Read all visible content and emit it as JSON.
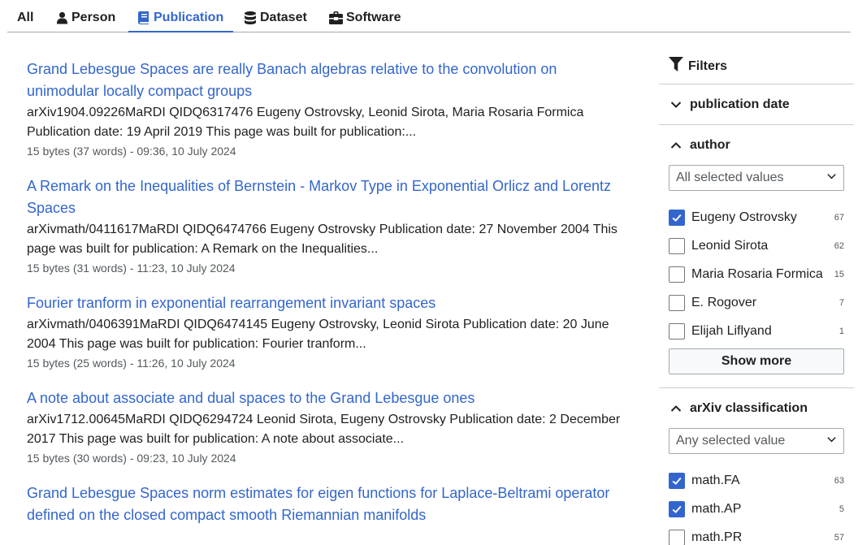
{
  "tabs": [
    {
      "label": "All",
      "icon": "none"
    },
    {
      "label": "Person",
      "icon": "person-icon"
    },
    {
      "label": "Publication",
      "icon": "book-icon"
    },
    {
      "label": "Dataset",
      "icon": "database-icon"
    },
    {
      "label": "Software",
      "icon": "toolbox-icon"
    }
  ],
  "active_tab": "Publication",
  "accent_color": "#3366cc",
  "results": [
    {
      "title_l1": "Grand Lebesgue Spaces are really Banach algebras relative to the convolution on",
      "title_l2": "unimodular locally compact groups",
      "snippet_l1": "arXiv1904.09226MaRDI QIDQ6317476 Eugeny Ostrovsky, Leonid Sirota, Maria Rosaria Formica",
      "snippet_l2": "Publication date: 19 April 2019 This page was built for publication:...",
      "meta": "15 bytes (37 words) - 09:36, 10 July 2024"
    },
    {
      "title_l1": "A Remark on the Inequalities of Bernstein - Markov Type in Exponential Orlicz and Lorentz",
      "title_l2": "Spaces",
      "snippet_l1": "arXivmath/0411617MaRDI QIDQ6474766 Eugeny Ostrovsky Publication date: 27 November 2004 This",
      "snippet_l2": "page was built for publication: A Remark on the Inequalities...",
      "meta": "15 bytes (31 words) - 11:23, 10 July 2024"
    },
    {
      "title_l1": "Fourier tranform in exponential rearrangement invariant spaces",
      "title_l2": "",
      "snippet_l1": "arXivmath/0406391MaRDI QIDQ6474145 Eugeny Ostrovsky, Leonid Sirota Publication date: 20 June",
      "snippet_l2": "2004 This page was built for publication: Fourier tranform...",
      "meta": "15 bytes (25 words) - 11:26, 10 July 2024"
    },
    {
      "title_l1": "A note about associate and dual spaces to the Grand Lebesgue ones",
      "title_l2": "",
      "snippet_l1": "arXiv1712.00645MaRDI QIDQ6294724 Leonid Sirota, Eugeny Ostrovsky Publication date: 2 December",
      "snippet_l2": "2017 This page was built for publication: A note about associate...",
      "meta": "15 bytes (30 words) - 09:23, 10 July 2024"
    },
    {
      "title_l1": "Grand Lebesgue Spaces norm estimates for eigen functions for Laplace-Beltrami operator",
      "title_l2": "defined on the closed compact smooth Riemannian manifolds",
      "snippet_l1": "",
      "snippet_l2": "",
      "meta": ""
    }
  ],
  "sidebar": {
    "filters_label": "Filters",
    "publication_date": {
      "label": "publication date",
      "expanded": false
    },
    "author": {
      "label": "author",
      "expanded": true,
      "select_value": "All selected values",
      "options": [
        {
          "label": "Eugeny Ostrovsky",
          "count": "67",
          "checked": true
        },
        {
          "label": "Leonid Sirota",
          "count": "62",
          "checked": false
        },
        {
          "label": "Maria Rosaria Formica",
          "count": "15",
          "checked": false
        },
        {
          "label": "E. Rogover",
          "count": "7",
          "checked": false
        },
        {
          "label": "Elijah Liflyand",
          "count": "1",
          "checked": false
        }
      ],
      "show_more_label": "Show more"
    },
    "arxiv": {
      "label": "arXiv classification",
      "expanded": true,
      "select_value": "Any selected value",
      "options": [
        {
          "label": "math.FA",
          "count": "63",
          "checked": true
        },
        {
          "label": "math.AP",
          "count": "5",
          "checked": true
        },
        {
          "label": "math.PR",
          "count": "57",
          "checked": false
        }
      ]
    }
  }
}
